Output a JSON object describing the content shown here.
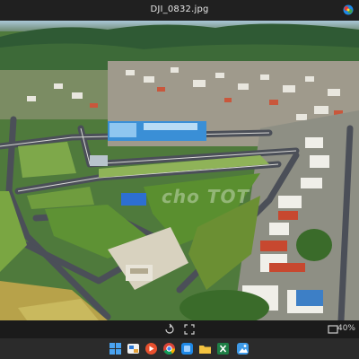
{
  "window": {
    "title": "DJI_0832.jpg"
  },
  "photo": {
    "watermark_text": "cho TOT"
  },
  "viewer_controls": {
    "zoom_level": "40%"
  },
  "icons": {
    "title_app": "copilot-icon",
    "rotate": "rotate-icon",
    "fit": "fit-to-window-icon",
    "fullscreen": "fullscreen-icon"
  },
  "taskbar": {
    "items": [
      "start-icon",
      "file-explorer-icon",
      "media-icon",
      "chrome-icon",
      "edge-icon",
      "folder-icon",
      "excel-icon",
      "photos-icon"
    ]
  },
  "colors": {
    "accent": "#6ab7ff",
    "titlebar": "#202020",
    "taskbar": "#2b2b2b"
  }
}
